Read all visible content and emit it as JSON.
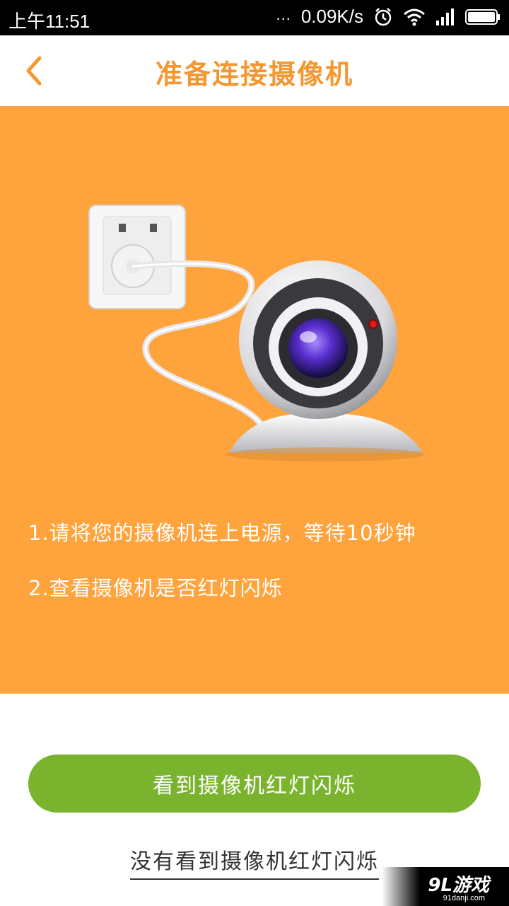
{
  "status_bar": {
    "time": "上午11:51",
    "dots": "...",
    "net_speed": "0.09K/s",
    "icons": [
      "alarm-icon",
      "wifi-icon",
      "signal-icon",
      "battery-icon"
    ]
  },
  "header": {
    "back_icon": "chevron-left-icon",
    "title": "准备连接摄像机"
  },
  "hero": {
    "illustration": "camera-plugged-into-outlet",
    "steps": [
      "1.请将您的摄像机连上电源，等待10秒钟",
      "2.查看摄像机是否红灯闪烁"
    ]
  },
  "actions": {
    "primary_label": "看到摄像机红灯闪烁",
    "secondary_label": "没有看到摄像机红灯闪烁"
  },
  "watermark": {
    "logo": "9L游戏",
    "url": "91danji.com"
  },
  "colors": {
    "accent": "#f6962e",
    "hero_bg": "#ffa33d",
    "primary_button": "#7ab42e"
  }
}
